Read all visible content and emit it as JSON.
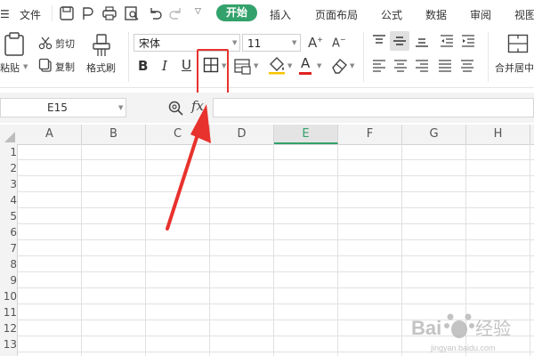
{
  "menubar": {
    "file_label": "文件",
    "tabs": [
      {
        "label": "开始",
        "active": true
      },
      {
        "label": "插入"
      },
      {
        "label": "页面布局"
      },
      {
        "label": "公式"
      },
      {
        "label": "数据"
      },
      {
        "label": "审阅"
      },
      {
        "label": "视图"
      }
    ]
  },
  "ribbon": {
    "paste_label": "粘贴",
    "cut_label": "剪切",
    "copy_label": "复制",
    "format_painter_label": "格式刷",
    "font_name": "宋体",
    "font_size": "11",
    "bold_label": "B",
    "italic_label": "I",
    "underline_label": "U",
    "font_color_letter": "A",
    "merge_label": "合并居中"
  },
  "formula_bar": {
    "name_box": "E15",
    "fx_label": "fx",
    "formula_value": ""
  },
  "sheet": {
    "columns": [
      "A",
      "B",
      "C",
      "D",
      "E",
      "F",
      "G",
      "H"
    ],
    "selected_column": "E",
    "rows": [
      "1",
      "2",
      "3",
      "4",
      "5",
      "6",
      "7",
      "8",
      "9",
      "10",
      "11",
      "12",
      "13"
    ]
  },
  "annotation": {
    "box_color": "#e8322d",
    "arrow_color": "#e8322d"
  },
  "watermark": {
    "brand": "Bai",
    "suffix": "经验",
    "url": "jingyan.baidu.com"
  },
  "colors": {
    "accent": "#33a16b",
    "selected_column_line": "#33a16b"
  }
}
